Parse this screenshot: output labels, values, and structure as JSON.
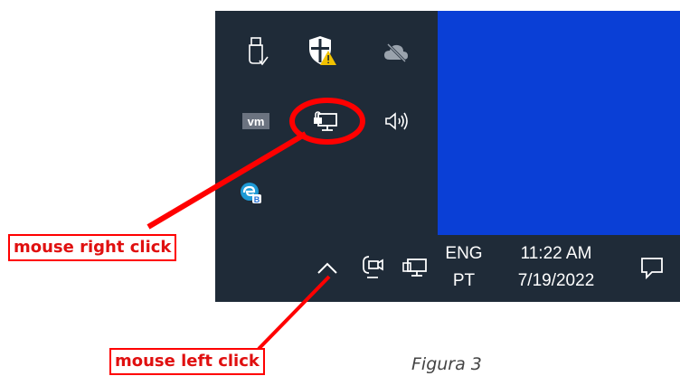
{
  "flyout": {
    "icons": [
      {
        "name": "usb-safely-remove-icon"
      },
      {
        "name": "windows-security-warning-icon"
      },
      {
        "name": "onedrive-offline-icon"
      },
      {
        "name": "vmware-icon"
      },
      {
        "name": "network-computer-icon"
      },
      {
        "name": "volume-icon"
      },
      {
        "name": "edge-beta-icon"
      }
    ]
  },
  "taskbar": {
    "language_line1": "ENG",
    "language_line2": "PT",
    "time": "11:22 AM",
    "date": "7/19/2022"
  },
  "annotations": {
    "right_click_label": "mouse right click",
    "left_click_label": "mouse left click",
    "figure_caption": "Figura 3",
    "highlight_color": "#ff0000"
  },
  "colors": {
    "taskbar_bg": "#1f2b38",
    "desktop_bg": "#0a3fd6",
    "warning_yellow": "#f2c200"
  }
}
